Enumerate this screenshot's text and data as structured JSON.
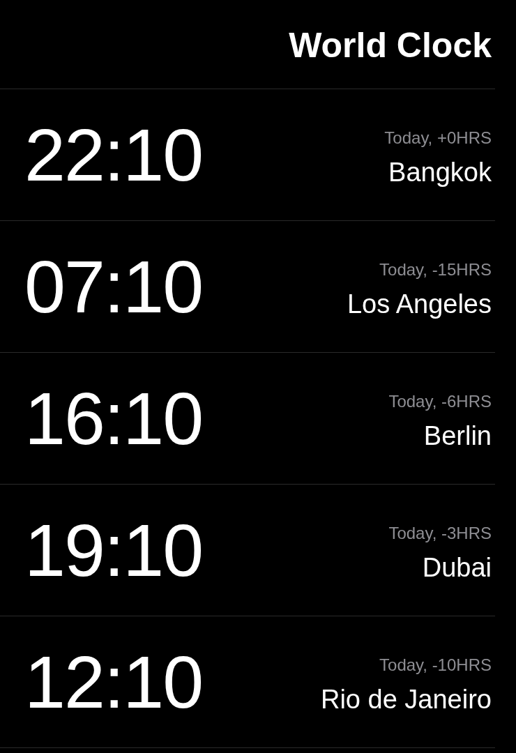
{
  "title": "World Clock",
  "clocks": [
    {
      "offset": "Today, +0HRS",
      "city": "Bangkok",
      "time": "22:10"
    },
    {
      "offset": "Today, -15HRS",
      "city": "Los Angeles",
      "time": "07:10"
    },
    {
      "offset": "Today, -6HRS",
      "city": "Berlin",
      "time": "16:10"
    },
    {
      "offset": "Today, -3HRS",
      "city": "Dubai",
      "time": "19:10"
    },
    {
      "offset": "Today, -10HRS",
      "city": "Rio de Janeiro",
      "time": "12:10"
    }
  ]
}
